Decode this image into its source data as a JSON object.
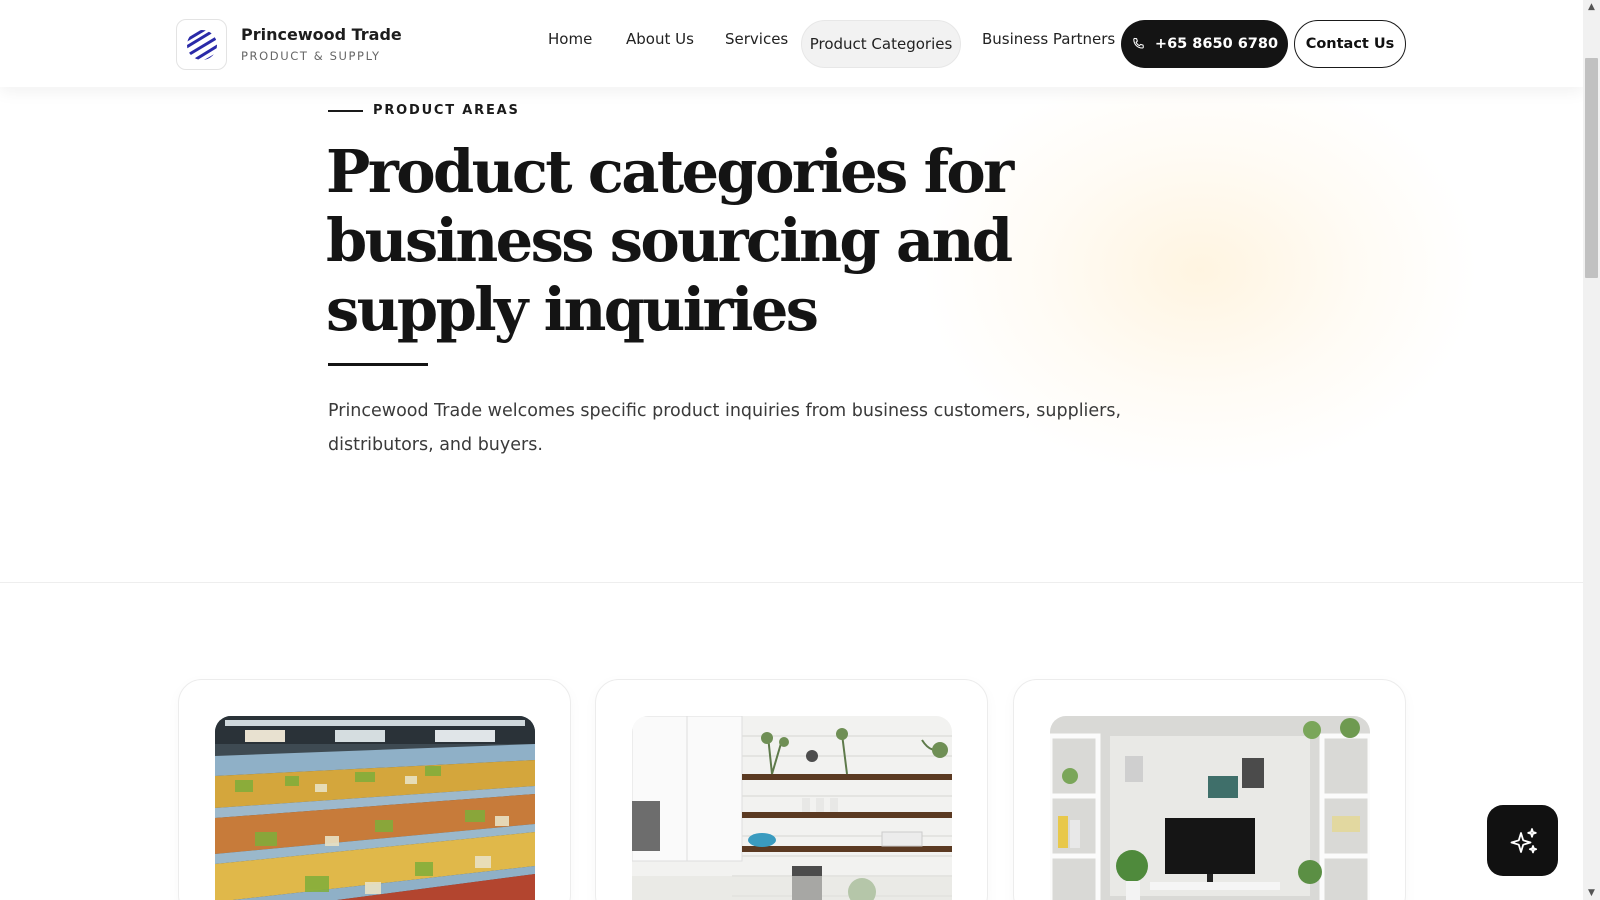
{
  "brand": {
    "name": "Princewood Trade",
    "tagline": "PRODUCT & SUPPLY",
    "logo_icon": "striped-globe-icon",
    "accent": "#2a2aa8"
  },
  "nav": {
    "items": [
      {
        "label": "Home"
      },
      {
        "label": "About Us"
      },
      {
        "label": "Services"
      },
      {
        "label": "Product Categories",
        "active": true
      },
      {
        "label": "Business Partners"
      }
    ],
    "phone": {
      "label": "+65 8650 6780",
      "icon": "phone-icon"
    },
    "contact_label": "Contact Us"
  },
  "hero": {
    "eyebrow": "PRODUCT AREAS",
    "title_lines": [
      "Product categories for",
      "business sourcing and",
      "supply inquiries"
    ],
    "description": "Princewood Trade welcomes specific product inquiries from business customers, suppliers, distributors, and buyers."
  },
  "cards": [
    {
      "image": "supermarket-aisle-photo"
    },
    {
      "image": "kitchen-shelves-photo"
    },
    {
      "image": "home-office-tv-photo"
    }
  ],
  "fab": {
    "icon": "sparkles-icon"
  },
  "colors": {
    "dark": "#141414",
    "background": "#ffffff",
    "glow": "#fff1d8"
  }
}
